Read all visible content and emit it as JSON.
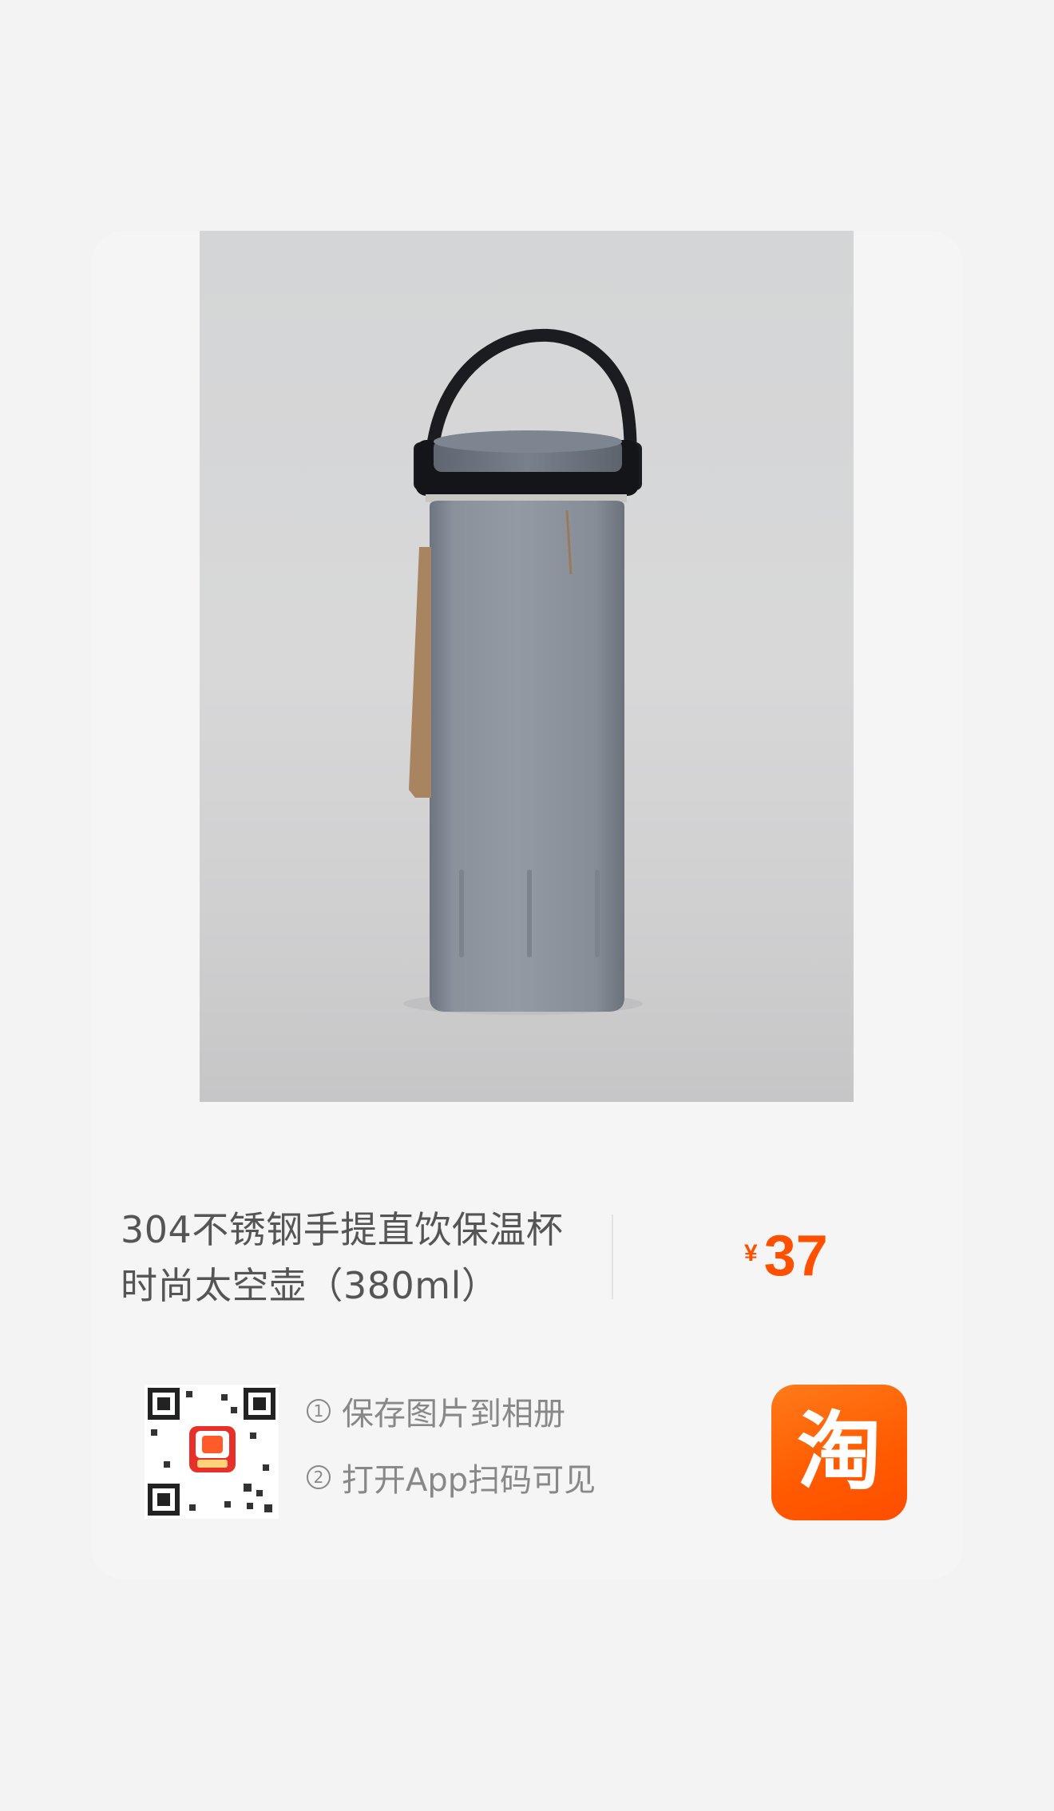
{
  "product": {
    "title_line1": "304不锈钢手提直饮保温杯",
    "title_line2": "时尚太空壶（380ml）",
    "currency": "¥",
    "price": "37"
  },
  "share": {
    "step1_num": "1",
    "step1_text": "保存图片到相册",
    "step2_num": "2",
    "step2_text": "打开App扫码可见"
  },
  "app": {
    "icon_char": "淘",
    "brand_color": "#ff5000"
  }
}
